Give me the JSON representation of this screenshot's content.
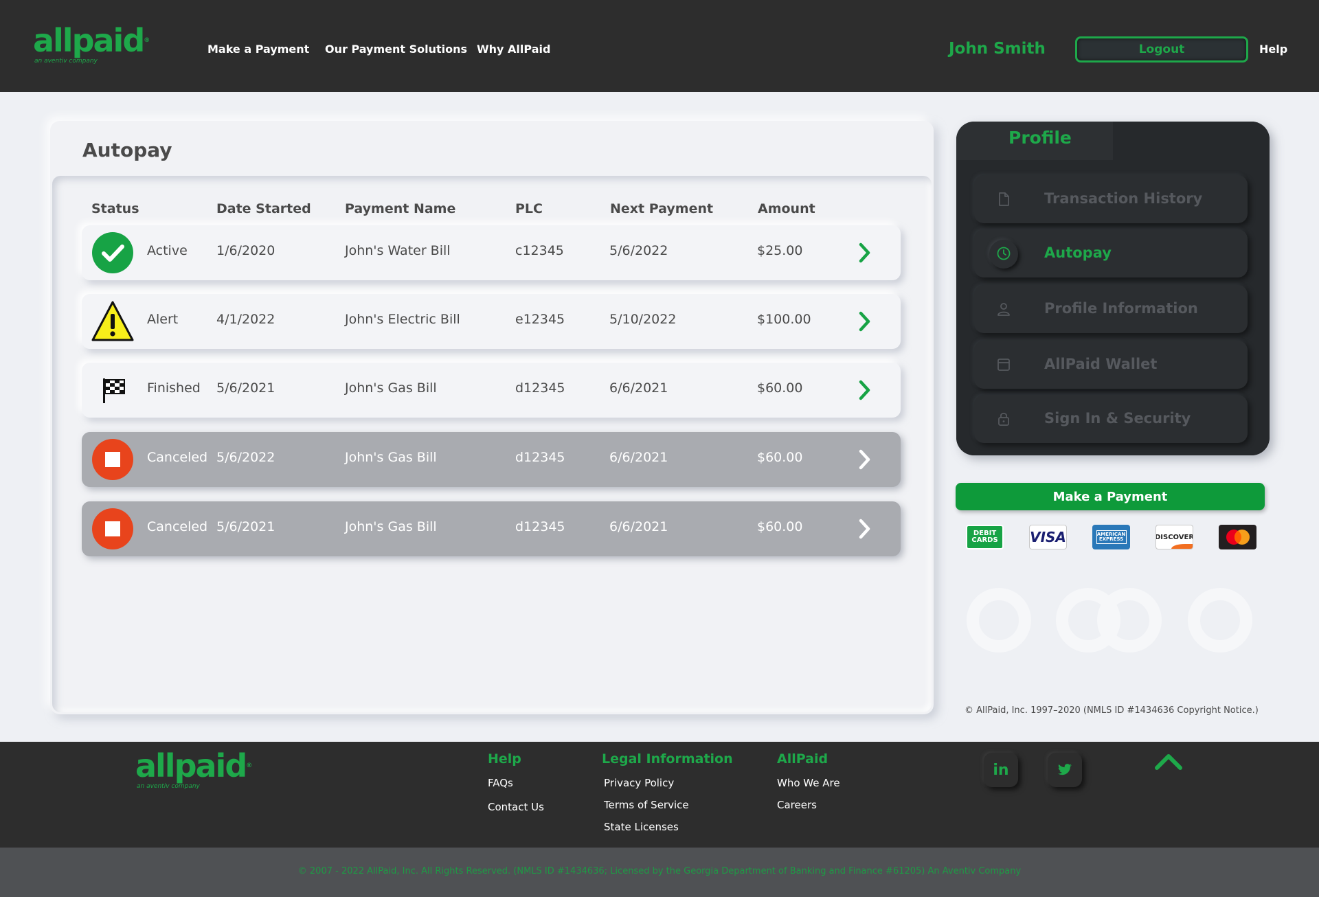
{
  "header": {
    "logo_text": "allpaid",
    "logo_tagline": "an aventiv company",
    "nav": [
      "Make a Payment",
      "Our Payment Solutions",
      "Why AllPaid"
    ],
    "user_name": "John Smith",
    "logout_label": "Logout",
    "help_label": "Help"
  },
  "autopay": {
    "title": "Autopay",
    "columns": [
      "Status",
      "Date Started",
      "Payment Name",
      "PLC",
      "Next Payment",
      "Amount"
    ],
    "rows": [
      {
        "status": "Active",
        "icon": "check-circle-icon",
        "date_started": "1/6/2020",
        "payment_name": "John's Water Bill",
        "plc": "c12345",
        "next_payment": "5/6/2022",
        "amount": "$25.00"
      },
      {
        "status": "Alert",
        "icon": "warning-icon",
        "date_started": "4/1/2022",
        "payment_name": "John's Electric Bill",
        "plc": "e12345",
        "next_payment": "5/10/2022",
        "amount": "$100.00"
      },
      {
        "status": "Finished",
        "icon": "checkered-flag-icon",
        "date_started": "5/6/2021",
        "payment_name": "John's Gas Bill",
        "plc": "d12345",
        "next_payment": "6/6/2021",
        "amount": "$60.00"
      },
      {
        "status": "Canceled",
        "icon": "stop-icon",
        "date_started": "5/6/2022",
        "payment_name": "John's Gas Bill",
        "plc": "d12345",
        "next_payment": "6/6/2021",
        "amount": "$60.00"
      },
      {
        "status": "Canceled",
        "icon": "stop-icon",
        "date_started": "5/6/2021",
        "payment_name": "John's Gas Bill",
        "plc": "d12345",
        "next_payment": "6/6/2021",
        "amount": "$60.00"
      }
    ]
  },
  "profile": {
    "title": "Profile",
    "items": [
      {
        "label": "Transaction History",
        "icon": "document-icon"
      },
      {
        "label": "Autopay",
        "icon": "clock-icon",
        "active": true
      },
      {
        "label": "Profile Information",
        "icon": "user-icon"
      },
      {
        "label": "AllPaid Wallet",
        "icon": "wallet-icon"
      },
      {
        "label": "Sign In & Security",
        "icon": "lock-icon"
      }
    ]
  },
  "payment": {
    "button_label": "Make a Payment",
    "cards": [
      {
        "name": "debit-cards",
        "text": "DEBIT CARDS"
      },
      {
        "name": "visa",
        "text": "VISA"
      },
      {
        "name": "american-express",
        "text": "AMERICAN EXPRESS"
      },
      {
        "name": "discover",
        "text": "DISCOVER"
      },
      {
        "name": "mastercard",
        "text": ""
      }
    ]
  },
  "copyright": "© AllPaid, Inc. 1997–2020 (NMLS ID #1434636 Copyright Notice.)",
  "footer": {
    "logo_text": "allpaid",
    "logo_tagline": "an aventiv company",
    "help": {
      "title": "Help",
      "links": [
        "FAQs",
        "Contact Us"
      ]
    },
    "legal": {
      "title": "Legal Information",
      "links": [
        "Privacy Policy",
        "Terms of Service",
        "State Licenses"
      ]
    },
    "allpaid": {
      "title": "AllPaid",
      "links": [
        "Who We Are",
        "Careers"
      ]
    },
    "social": [
      "in"
    ],
    "legal_text": "© 2007 - 2022 AllPaid, Inc. All Rights Reserved. (NMLS ID #1434636; Licensed by the Georgia Department of Banking and Finance #61205) An Aventiv Company"
  },
  "colors": {
    "brand": "#1ea84a",
    "dark": "#2d2d2d",
    "canceled": "#e8441c",
    "alert": "#f7ee1a"
  }
}
